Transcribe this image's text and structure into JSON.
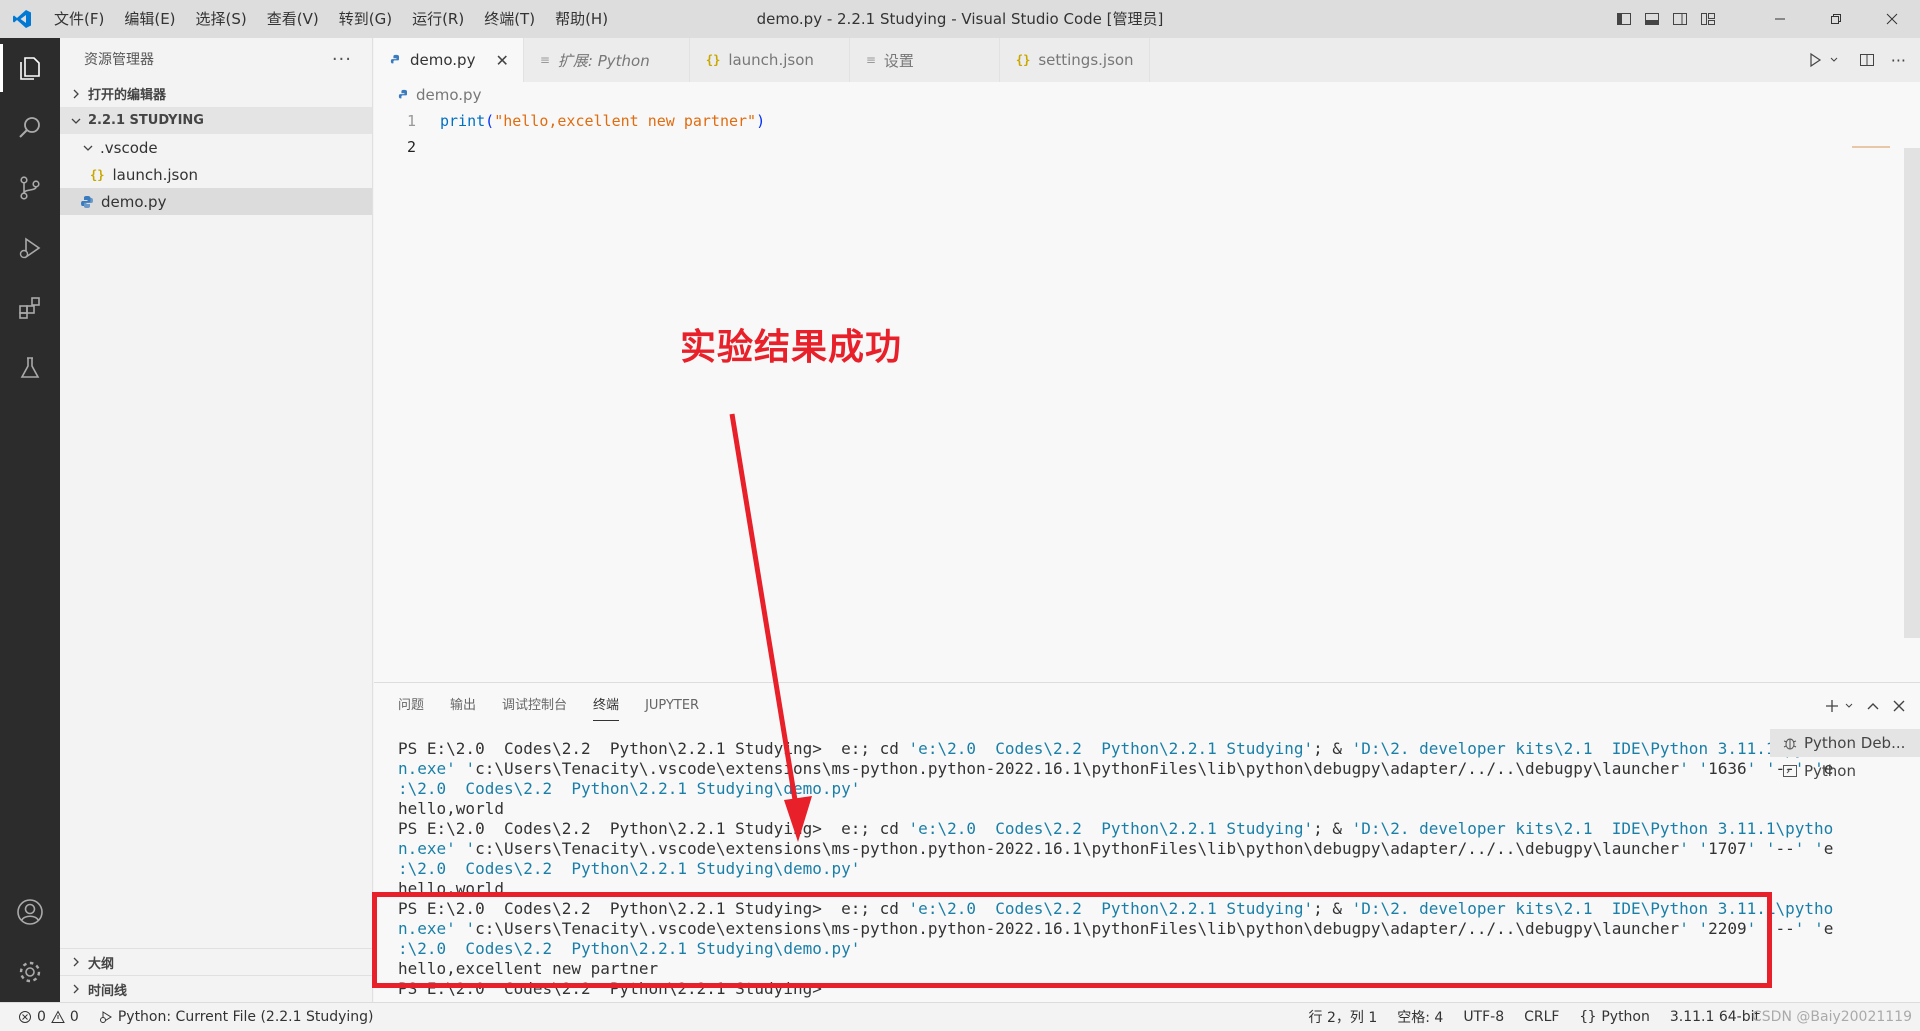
{
  "window": {
    "title": "demo.py - 2.2.1 Studying - Visual Studio Code [管理员]"
  },
  "menu": [
    "文件(F)",
    "编辑(E)",
    "选择(S)",
    "查看(V)",
    "转到(G)",
    "运行(R)",
    "终端(T)",
    "帮助(H)"
  ],
  "sidebar": {
    "title": "资源管理器",
    "more": "···",
    "open_editors": "打开的编辑器",
    "workspace": "2.2.1 STUDYING",
    "items": [
      {
        "label": ".vscode"
      },
      {
        "label": "launch.json"
      },
      {
        "label": "demo.py"
      }
    ],
    "outline": "大纲",
    "timeline": "时间线"
  },
  "tabs": [
    {
      "label": "demo.py",
      "close": "✕"
    },
    {
      "label": "扩展: Python"
    },
    {
      "label": "launch.json"
    },
    {
      "label": "设置"
    },
    {
      "label": "settings.json"
    }
  ],
  "breadcrumb": "demo.py",
  "code": {
    "line_numbers": [
      "1",
      "2"
    ],
    "fn": "print",
    "open": "(",
    "str": "\"hello,excellent new partner\"",
    "close": ")"
  },
  "annotation": "实验结果成功",
  "panel": {
    "tabs": [
      "问题",
      "输出",
      "调试控制台",
      "终端",
      "JUPYTER"
    ],
    "active_tab": "终端",
    "terminals": [
      "Python Deb...",
      "Python"
    ],
    "lines": [
      "PS E:\\2.0  Codes\\2.2  Python\\2.2.1 Studying>  e:; cd 'e:\\2.0  Codes\\2.2  Python\\2.2.1 Studying'; & 'D:\\2. developer kits\\2.1  IDE\\Python 3.11.1\\pytho",
      "n.exe' 'c:\\Users\\Tenacity\\.vscode\\extensions\\ms-python.python-2022.16.1\\pythonFiles\\lib\\python\\debugpy\\adapter/../..\\debugpy\\launcher' '1636' '--' 'e",
      ":\\2.0  Codes\\2.2  Python\\2.2.1 Studying\\demo.py'",
      "hello,world",
      "PS E:\\2.0  Codes\\2.2  Python\\2.2.1 Studying>  e:; cd 'e:\\2.0  Codes\\2.2  Python\\2.2.1 Studying'; & 'D:\\2. developer kits\\2.1  IDE\\Python 3.11.1\\pytho",
      "n.exe' 'c:\\Users\\Tenacity\\.vscode\\extensions\\ms-python.python-2022.16.1\\pythonFiles\\lib\\python\\debugpy\\adapter/../..\\debugpy\\launcher' '1707' '--' 'e",
      ":\\2.0  Codes\\2.2  Python\\2.2.1 Studying\\demo.py'",
      "hello,world",
      "PS E:\\2.0  Codes\\2.2  Python\\2.2.1 Studying>  e:; cd 'e:\\2.0  Codes\\2.2  Python\\2.2.1 Studying'; & 'D:\\2. developer kits\\2.1  IDE\\Python 3.11.1\\pytho",
      "n.exe' 'c:\\Users\\Tenacity\\.vscode\\extensions\\ms-python.python-2022.16.1\\pythonFiles\\lib\\python\\debugpy\\adapter/../..\\debugpy\\launcher' '2209' '--' 'e",
      ":\\2.0  Codes\\2.2  Python\\2.2.1 Studying\\demo.py'",
      "hello,excellent new partner",
      "PS E:\\2.0  Codes\\2.2  Python\\2.2.1 Studying> "
    ]
  },
  "status": {
    "errors": "0",
    "warnings": "0",
    "debug": "Python: Current File (2.2.1 Studying)",
    "position": "行 2，列 1",
    "spaces": "空格: 4",
    "encoding": "UTF-8",
    "eol": "CRLF",
    "language": "Python",
    "interpreter": "3.11.1 64-bit",
    "watermark": "CSDN @Baiy20021119"
  },
  "colors": {
    "accent_red": "#e8202a",
    "vscode_blue": "#0078d4"
  }
}
